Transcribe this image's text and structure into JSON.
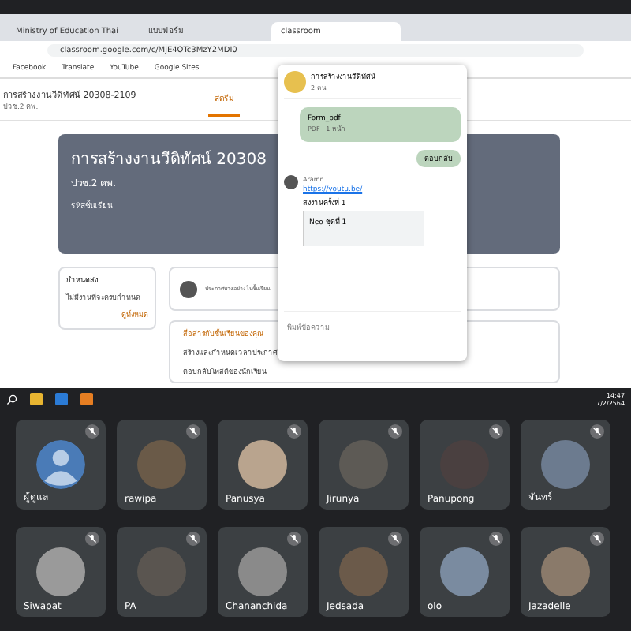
{
  "browser": {
    "tabs": [
      {
        "label": "Ministry of Education Thai",
        "selected": false
      },
      {
        "label": "แบบฟอร์ม",
        "selected": false
      },
      {
        "label": "classroom",
        "selected": true
      }
    ],
    "url": "classroom.google.com/c/MjE4OTc3MzY2MDI0",
    "bookmarks": [
      "Facebook",
      "Translate",
      "YouTube",
      "Google Sites"
    ]
  },
  "classroom": {
    "title": "การสร้างงานวีดิทัศน์ 20308-2109",
    "subtitle": "ปวช.2 คพ.",
    "tabs": [
      {
        "label": "สตรีม",
        "selected": true
      }
    ],
    "banner": {
      "title": "การสร้างงานวีดิทัศน์ 20308",
      "subtitle": "ปวช.2 คพ.",
      "code_label": "รหัสชั้นเรียน"
    },
    "upcoming": {
      "title": "กำหนดส่ง",
      "text": "ไม่มีงานที่จะครบกำหนด",
      "link": "ดูทั้งหมด"
    },
    "announce_placeholder": "ประกาศบางอย่างในชั้นเรียน",
    "todo": {
      "title": "สื่อสารกับชั้นเรียนของคุณ",
      "items": [
        "สร้างและกำหนดเวลาประกาศ",
        "ตอบกลับโพสต์ของนักเรียน"
      ]
    }
  },
  "chat": {
    "name": "การสร้างงานวีดิทัศน์",
    "sub": "2 คน",
    "file": {
      "name": "Form_pdf",
      "meta": "PDF · 1 หน้า"
    },
    "sent": "ตอบกลับ",
    "sender": "Aramn",
    "link": "https://youtu.be/",
    "message": "ส่งงานครั้งที่ 1",
    "preview": "Neo ชุดที่ 1",
    "placeholder": "พิมพ์ข้อความ"
  },
  "taskbar": {
    "time": "14:47",
    "date": "7/2/2564"
  },
  "participants": [
    {
      "name": "ผู้ดูแล",
      "kind": "default"
    },
    {
      "name": "rawipa",
      "kind": "photo"
    },
    {
      "name": "Panusya",
      "kind": "photo"
    },
    {
      "name": "Jirunya",
      "kind": "photo"
    },
    {
      "name": "Panupong",
      "kind": "photo"
    },
    {
      "name": "จันทร์",
      "kind": "photo"
    },
    {
      "name": "Siwapat",
      "kind": "photo"
    },
    {
      "name": "PA",
      "kind": "photo"
    },
    {
      "name": "Chananchida",
      "kind": "photo"
    },
    {
      "name": "Jedsada",
      "kind": "photo"
    },
    {
      "name": "olo",
      "kind": "photo"
    },
    {
      "name": "Jazadelle",
      "kind": "photo"
    }
  ]
}
